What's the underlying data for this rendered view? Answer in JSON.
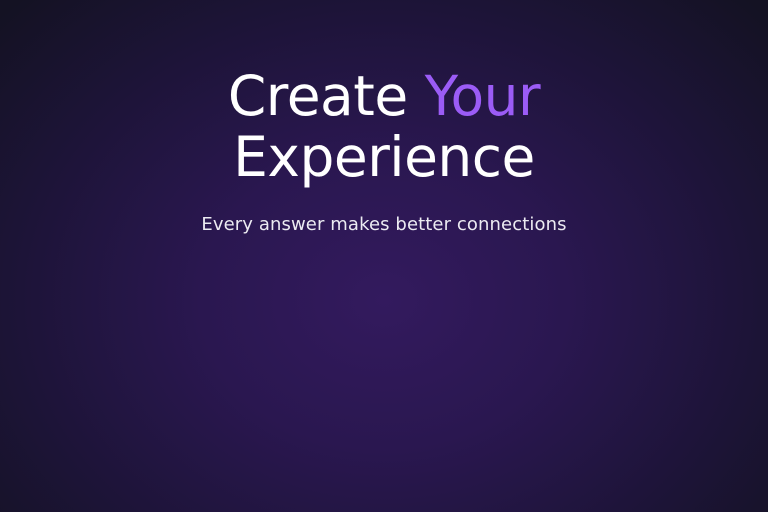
{
  "hero": {
    "title_part1": "Create",
    "title_accent": "Your",
    "title_line2": "Experience",
    "subtitle": "Every answer makes better connections"
  },
  "colors": {
    "accent": "#9b5cf6",
    "background_center": "#331a5e",
    "background_edge": "#141223",
    "text": "#ffffff"
  }
}
